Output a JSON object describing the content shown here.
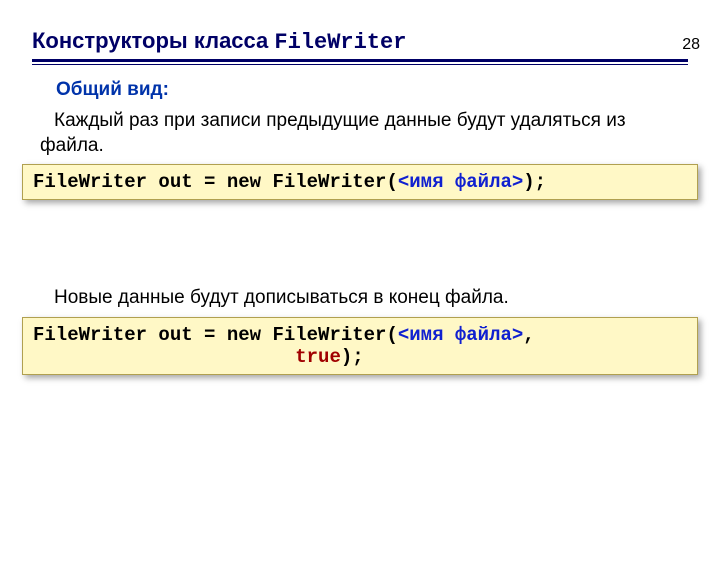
{
  "pageNumber": "28",
  "title": {
    "prefix": "Конструкторы класса ",
    "className": "FileWriter"
  },
  "subtitle": "Общий вид:",
  "para1": "Каждый раз при  записи предыдущие данные будут удаляться из файла.",
  "code1": {
    "t1": "FileWriter out = new FileWriter(",
    "arg": "<имя файла>",
    "t2": ");"
  },
  "para2": "Новые данные будут дописываться в конец файла.",
  "code2": {
    "t1": "FileWriter out = new FileWriter(",
    "arg": "<имя файла>",
    "t2": ", ",
    "indent": "                       ",
    "kw": "true",
    "t3": ");"
  }
}
